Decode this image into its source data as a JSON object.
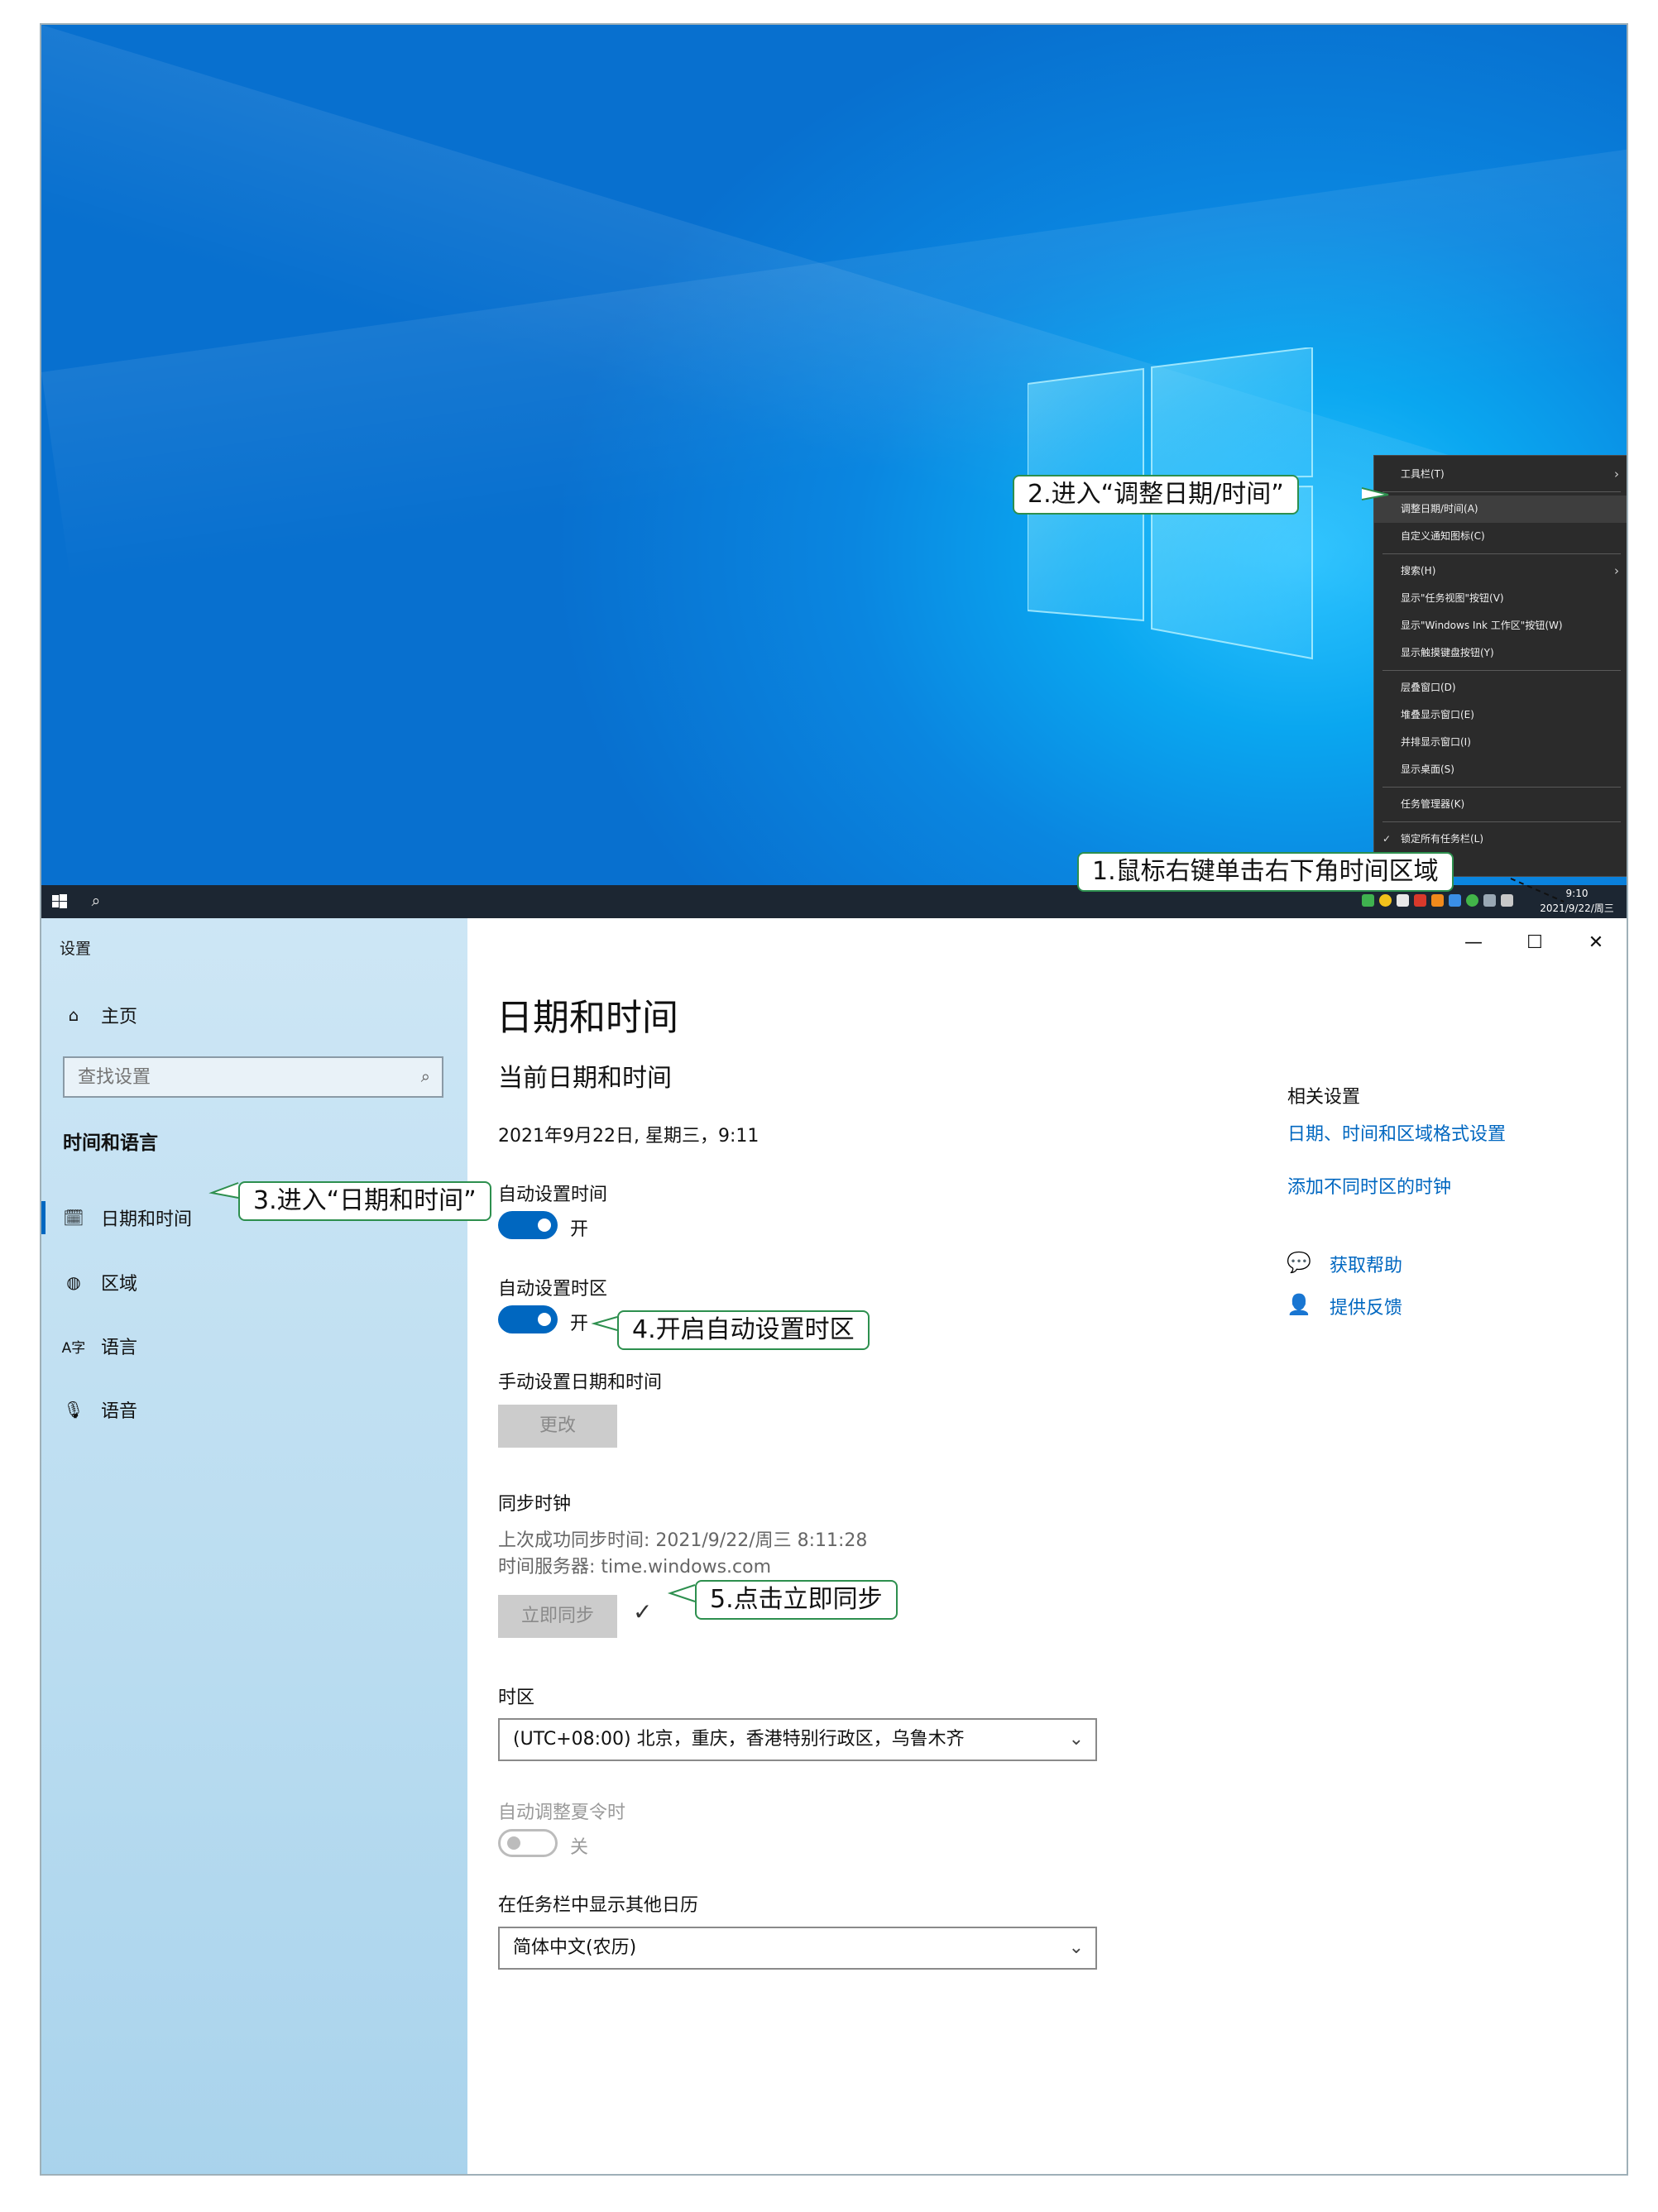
{
  "context_menu": {
    "items": [
      {
        "label": "工具栏(T)",
        "arrow": true
      },
      {
        "label": "调整日期/时间(A)",
        "highlight": true
      },
      {
        "label": "自定义通知图标(C)"
      },
      {
        "label": "搜索(H)",
        "arrow": true
      },
      {
        "label": "显示\"任务视图\"按钮(V)"
      },
      {
        "label": "显示\"Windows Ink 工作区\"按钮(W)"
      },
      {
        "label": "显示触摸键盘按钮(Y)"
      },
      {
        "label": "层叠窗口(D)"
      },
      {
        "label": "堆叠显示窗口(E)"
      },
      {
        "label": "并排显示窗口(I)"
      },
      {
        "label": "显示桌面(S)"
      },
      {
        "label": "任务管理器(K)"
      },
      {
        "label": "锁定所有任务栏(L)",
        "checked": true
      }
    ]
  },
  "taskbar": {
    "time": "9:10",
    "date": "2021/9/22/周三"
  },
  "callouts": {
    "c1": "1.鼠标右键单击右下角时间区域",
    "c2": "2.进入“调整日期/时间”",
    "c3": "3.进入“日期和时间”",
    "c4": "4.开启自动设置时区",
    "c5": "5.点击立即同步"
  },
  "window": {
    "title": "设置",
    "minimize": "—",
    "maximize": "☐",
    "close": "✕"
  },
  "sidebar": {
    "home": "主页",
    "search_placeholder": "查找设置",
    "group_title": "时间和语言",
    "items": [
      {
        "label": "日期和时间",
        "icon": "date-time-icon",
        "active": true
      },
      {
        "label": "区域",
        "icon": "globe-icon"
      },
      {
        "label": "语言",
        "icon": "language-icon"
      },
      {
        "label": "语音",
        "icon": "microphone-icon"
      }
    ]
  },
  "content": {
    "page_title": "日期和时间",
    "current_heading": "当前日期和时间",
    "current_value": "2021年9月22日, 星期三，9:11",
    "auto_time_label": "自动设置时间",
    "auto_time_state": "开",
    "auto_tz_label": "自动设置时区",
    "auto_tz_state": "开",
    "manual_label": "手动设置日期和时间",
    "change_button": "更改",
    "sync_heading": "同步时钟",
    "sync_last": "上次成功同步时间: 2021/9/22/周三 8:11:28",
    "sync_server": "时间服务器: time.windows.com",
    "sync_button": "立即同步",
    "sync_check": "✓",
    "tz_label": "时区",
    "tz_value": "(UTC+08:00) 北京，重庆，香港特别行政区，乌鲁木齐",
    "dst_label": "自动调整夏令时",
    "dst_state": "关",
    "calendar_label": "在任务栏中显示其他日历",
    "calendar_value": "简体中文(农历)"
  },
  "related": {
    "heading": "相关设置",
    "link1": "日期、时间和区域格式设置",
    "link2": "添加不同时区的时钟",
    "help": "获取帮助",
    "feedback": "提供反馈"
  },
  "colors": {
    "accent": "#0067c0",
    "callout_border": "#2d8f4e",
    "taskbar": "#1c2632",
    "menu_bg": "#2b2b2b"
  }
}
